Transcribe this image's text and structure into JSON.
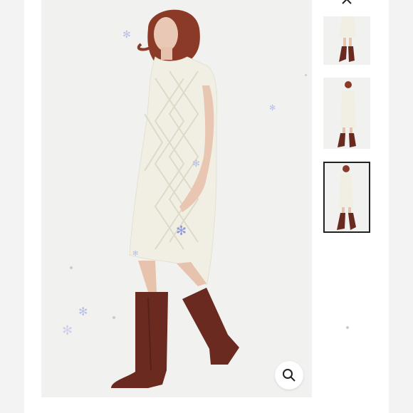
{
  "gallery": {
    "main_image_alt": "",
    "close_icon": "close-icon",
    "zoom_icon": "magnifier-icon",
    "selected_thumbnail": 3,
    "thumbnail_count": 3
  },
  "colors": {
    "dress": "#f1efe3",
    "boots": "#6a2a20",
    "background": "#f1f1f0",
    "selected_border": "#222222",
    "snowflake": "#b8c0e6"
  }
}
